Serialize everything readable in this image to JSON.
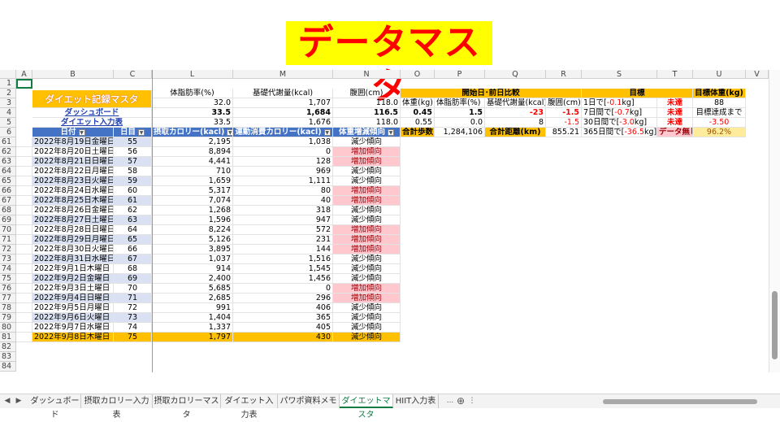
{
  "title": "データマスタ",
  "columns": [
    "A",
    "B",
    "C",
    "L",
    "M",
    "N",
    "O",
    "P",
    "Q",
    "R",
    "S",
    "T",
    "U",
    "V"
  ],
  "summary": {
    "r1": "",
    "headers_row2": {
      "L": "体脂肪率(%)",
      "M": "基礎代謝量(kcal)",
      "N": "腹囲(cm)",
      "OR": "開始日･前日比較",
      "S": "目標",
      "U": "目標体重(kg)"
    },
    "masta_label": "ダイエット記録マスタ",
    "row3": {
      "L": "32.0",
      "M": "1,707",
      "N": "118.0",
      "O": "体重(kg)",
      "P": "体脂肪率(%)",
      "Q": "基礎代謝量(kcal)",
      "R": "腹囲(cm)",
      "S_pre": "1日で[",
      "S_val": "-0.1",
      "S_post": "kg]",
      "T": "未達",
      "U": "88"
    },
    "dash_link": "ダッシュボード",
    "row4": {
      "L": "33.5",
      "M": "1,684",
      "N": "116.5",
      "O": "0.45",
      "P": "1.5",
      "Q": "-23",
      "R": "-1.5",
      "S_pre": "7日間で[",
      "S_val": "-0.7",
      "S_post": "kg]",
      "T": "未達",
      "U": "目標達成まで"
    },
    "input_link": "ダイエット入力表",
    "row5": {
      "L": "33.5",
      "M": "1,676",
      "N": "118.0",
      "O": "0.55",
      "P": "0.0",
      "Q": "8",
      "R": "-1.5",
      "S_pre": "30日間で[",
      "S_val": "-3.0",
      "S_post": "kg]",
      "T": "未達",
      "U": "-3.50"
    },
    "row6": {
      "B": "日付",
      "C": "日目",
      "L": "摂取カロリー(kacl)",
      "M": "運動消費カロリー(kacl)",
      "N": "体重増減傾向",
      "O": "合計歩数",
      "P": "1,284,106",
      "Q": "合計距離(km)",
      "R": "855.21",
      "S_pre": "365日間で[",
      "S_val": "-36.5",
      "S_post": "kg]",
      "T": "データ無し",
      "U": "96.2%"
    }
  },
  "row_numbers_top": [
    "1",
    "2",
    "3",
    "4",
    "5",
    "6"
  ],
  "rows": [
    {
      "n": "61",
      "date": "2022年8月19日金曜日",
      "day": "55",
      "intake": "2,195",
      "burn": "1,038",
      "trend": "減少傾向"
    },
    {
      "n": "62",
      "date": "2022年8月20日土曜日",
      "day": "56",
      "intake": "8,894",
      "burn": "0",
      "trend": "増加傾向"
    },
    {
      "n": "63",
      "date": "2022年8月21日日曜日",
      "day": "57",
      "intake": "4,441",
      "burn": "128",
      "trend": "増加傾向"
    },
    {
      "n": "64",
      "date": "2022年8月22日月曜日",
      "day": "58",
      "intake": "710",
      "burn": "969",
      "trend": "減少傾向"
    },
    {
      "n": "65",
      "date": "2022年8月23日火曜日",
      "day": "59",
      "intake": "1,659",
      "burn": "1,111",
      "trend": "減少傾向"
    },
    {
      "n": "66",
      "date": "2022年8月24日水曜日",
      "day": "60",
      "intake": "5,317",
      "burn": "80",
      "trend": "増加傾向"
    },
    {
      "n": "67",
      "date": "2022年8月25日木曜日",
      "day": "61",
      "intake": "7,074",
      "burn": "40",
      "trend": "増加傾向"
    },
    {
      "n": "68",
      "date": "2022年8月26日金曜日",
      "day": "62",
      "intake": "1,268",
      "burn": "318",
      "trend": "減少傾向"
    },
    {
      "n": "69",
      "date": "2022年8月27日土曜日",
      "day": "63",
      "intake": "1,596",
      "burn": "947",
      "trend": "減少傾向"
    },
    {
      "n": "70",
      "date": "2022年8月28日日曜日",
      "day": "64",
      "intake": "8,224",
      "burn": "572",
      "trend": "増加傾向"
    },
    {
      "n": "71",
      "date": "2022年8月29日月曜日",
      "day": "65",
      "intake": "5,126",
      "burn": "231",
      "trend": "増加傾向"
    },
    {
      "n": "72",
      "date": "2022年8月30日火曜日",
      "day": "66",
      "intake": "3,895",
      "burn": "144",
      "trend": "増加傾向"
    },
    {
      "n": "73",
      "date": "2022年8月31日水曜日",
      "day": "67",
      "intake": "1,037",
      "burn": "1,516",
      "trend": "減少傾向"
    },
    {
      "n": "74",
      "date": "2022年9月1日木曜日",
      "day": "68",
      "intake": "914",
      "burn": "1,545",
      "trend": "減少傾向"
    },
    {
      "n": "75",
      "date": "2022年9月2日金曜日",
      "day": "69",
      "intake": "2,400",
      "burn": "1,456",
      "trend": "減少傾向"
    },
    {
      "n": "76",
      "date": "2022年9月3日土曜日",
      "day": "70",
      "intake": "5,685",
      "burn": "0",
      "trend": "増加傾向"
    },
    {
      "n": "77",
      "date": "2022年9月4日日曜日",
      "day": "71",
      "intake": "2,685",
      "burn": "296",
      "trend": "増加傾向"
    },
    {
      "n": "78",
      "date": "2022年9月5日月曜日",
      "day": "72",
      "intake": "991",
      "burn": "406",
      "trend": "減少傾向"
    },
    {
      "n": "79",
      "date": "2022年9月6日火曜日",
      "day": "73",
      "intake": "1,404",
      "burn": "365",
      "trend": "減少傾向"
    },
    {
      "n": "80",
      "date": "2022年9月7日水曜日",
      "day": "74",
      "intake": "1,337",
      "burn": "405",
      "trend": "減少傾向"
    },
    {
      "n": "81",
      "date": "2022年9月8日木曜日",
      "day": "75",
      "intake": "1,797",
      "burn": "430",
      "trend": "減少傾向",
      "highlight": true
    }
  ],
  "empty_rows": [
    "82",
    "83",
    "84"
  ],
  "tabs": [
    "ダッシュボード",
    "摂取カロリー入力表",
    "摂取カロリーマスタ",
    "ダイエット入力表",
    "パワポ資料メモ",
    "ダイエットマスタ",
    "HIIT入力表"
  ],
  "active_tab": "ダイエットマスタ",
  "tab_overflow": "...",
  "nav": {
    "prev": "◀",
    "next": "▶",
    "add": "⊕",
    "more": "⋮"
  }
}
